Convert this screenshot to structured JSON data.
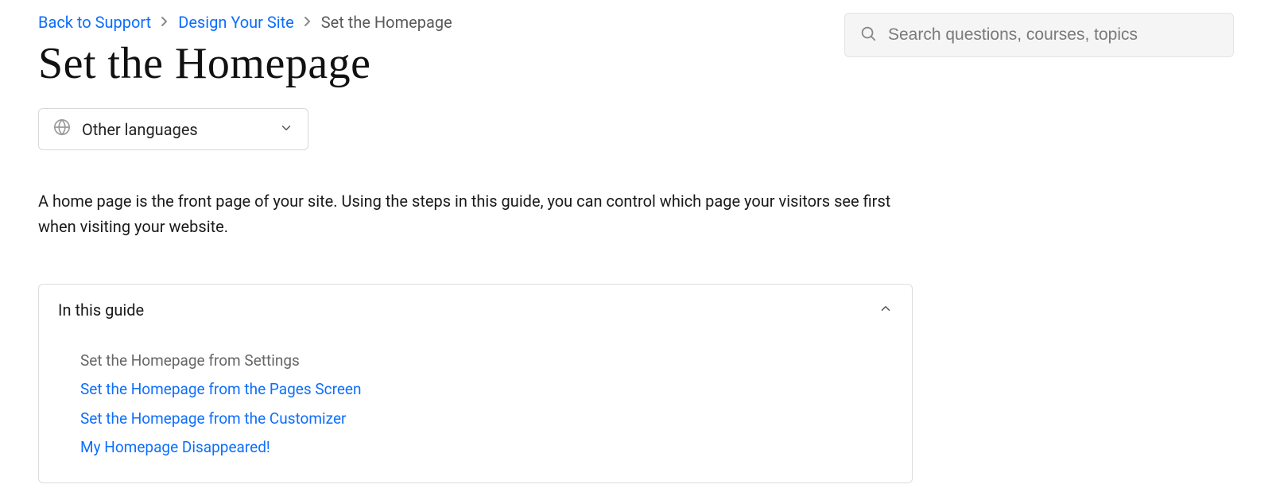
{
  "breadcrumb": {
    "back": "Back to Support",
    "section": "Design Your Site",
    "current": "Set the Homepage"
  },
  "title": "Set the Homepage",
  "language_selector": {
    "label": "Other languages"
  },
  "search": {
    "placeholder": "Search questions, courses, topics"
  },
  "intro": "A home page is the front page of your site. Using the steps in this guide, you can control which page your visitors see first when visiting your website.",
  "toc": {
    "heading": "In this guide",
    "items": [
      {
        "label": "Set the Homepage from Settings",
        "active": true
      },
      {
        "label": "Set the Homepage from the Pages Screen",
        "active": false
      },
      {
        "label": "Set the Homepage from the Customizer",
        "active": false
      },
      {
        "label": "My Homepage Disappeared!",
        "active": false
      }
    ]
  }
}
